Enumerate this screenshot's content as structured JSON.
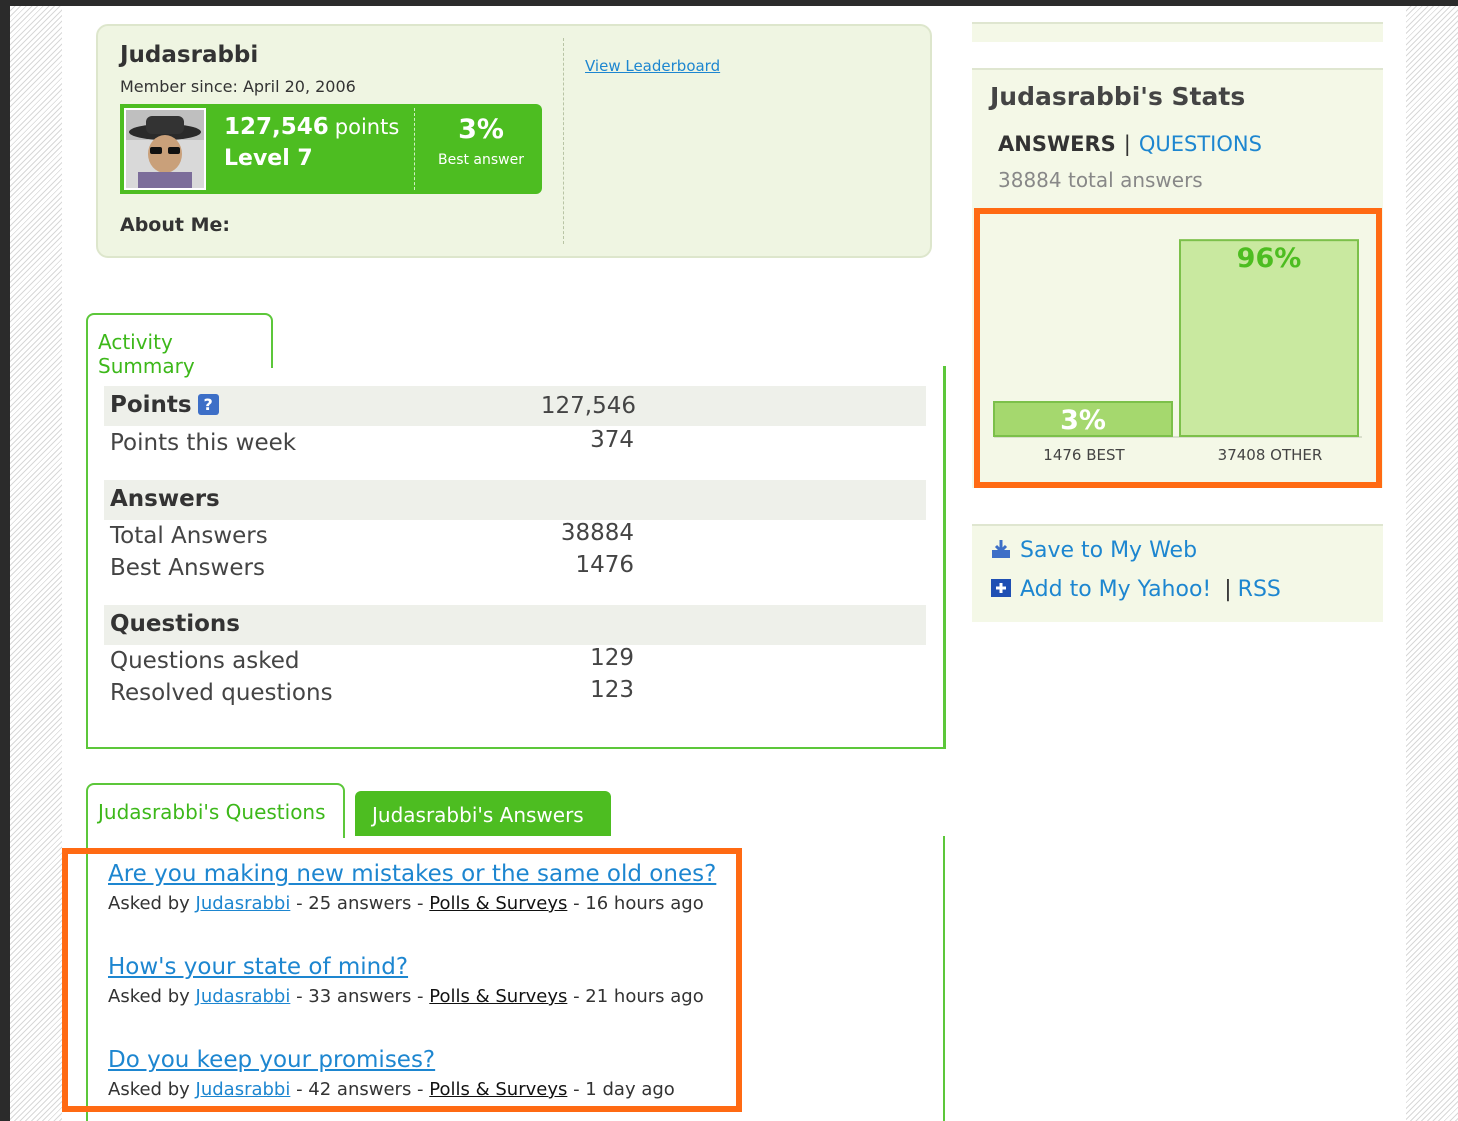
{
  "profile": {
    "name": "Judasrabbi",
    "member_since": "Member since: April 20, 2006",
    "points_value": "127,546",
    "points_word": "points",
    "level": "Level 7",
    "best_answer_pct": "3%",
    "best_answer_label": "Best answer",
    "about_label": "About Me:",
    "leaderboard_link": "View Leaderboard"
  },
  "activity": {
    "tab_label": "Activity Summary",
    "points_header": "Points",
    "points_total": "127,546",
    "points_week_label": "Points this week",
    "points_week_value": "374",
    "answers_header": "Answers",
    "total_answers_label": "Total Answers",
    "total_answers_value": "38884",
    "best_answers_label": "Best Answers",
    "best_answers_value": "1476",
    "questions_header": "Questions",
    "questions_asked_label": "Questions asked",
    "questions_asked_value": "129",
    "resolved_label": "Resolved questions",
    "resolved_value": "123"
  },
  "qa_tabs": {
    "questions_tab": "Judasrabbi's Questions",
    "answers_tab": "Judasrabbi's Answers"
  },
  "questions": [
    {
      "title": "Are you making new mistakes or the same old ones?",
      "asked_by": "Asked by",
      "user": "Judasrabbi",
      "answers": "- 25 answers -",
      "category": "Polls & Surveys",
      "time": "- 16 hours ago"
    },
    {
      "title": "How's your state of mind?",
      "asked_by": "Asked by",
      "user": "Judasrabbi",
      "answers": "- 33 answers -",
      "category": "Polls & Surveys",
      "time": "- 21 hours ago"
    },
    {
      "title": "Do you keep your promises?",
      "asked_by": "Asked by",
      "user": "Judasrabbi",
      "answers": "- 42 answers -",
      "category": "Polls & Surveys",
      "time": "- 1 day ago"
    }
  ],
  "stats": {
    "title": "Judasrabbi's Stats",
    "tab_answers": "ANSWERS",
    "tab_separator": "|",
    "tab_questions": "QUESTIONS",
    "total_answers": "38884 total answers"
  },
  "chart_data": {
    "type": "bar",
    "categories": [
      "1476 BEST",
      "37408 OTHER"
    ],
    "values": [
      3,
      96
    ],
    "data_labels": [
      "3%",
      "96%"
    ],
    "ylim": [
      0,
      100
    ],
    "colors": [
      "#a5d86e",
      "#c9e9a0"
    ],
    "label_colors": [
      "#ffffff",
      "#4dbd21"
    ]
  },
  "share": {
    "save_web": "Save to My Web",
    "add_yahoo": "Add to My Yahoo!",
    "separator": "|",
    "rss": "RSS"
  },
  "colors": {
    "accent_green": "#4dbd21",
    "link_blue": "#1d86d0",
    "highlight_orange": "#ff6a13"
  }
}
